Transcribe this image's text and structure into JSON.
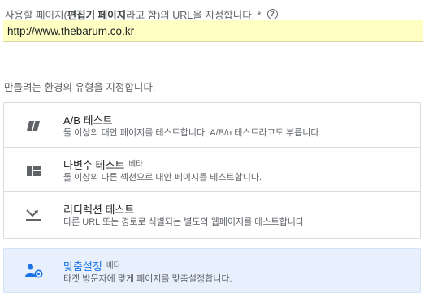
{
  "url_section": {
    "label_prefix": "사용할 페이지(",
    "label_bold": "편집기 페이지",
    "label_suffix": "라고 함)의 URL을 지정합니다. *",
    "help_icon": "help-circle-icon",
    "url_value": "http://www.thebarum.co.kr"
  },
  "environment": {
    "prompt": "만들려는 환경의 유형을 지정합니다.",
    "options": [
      {
        "icon": "ab-test-icon",
        "title": "A/B 테스트",
        "beta": "",
        "description": "둘 이상의 대안 페이지를 테스트합니다. A/B/n 테스트라고도 부릅니다."
      },
      {
        "icon": "multivariate-grid-icon",
        "title": "다변수 테스트",
        "beta": "베타",
        "description": "둘 이상의 다른 섹션으로 대안 페이지를 테스트합니다."
      },
      {
        "icon": "redirect-arrow-icon",
        "title": "리디렉션 테스트",
        "beta": "",
        "description": "다른 URL 또는 경로로 식별되는 별도의 웹페이지를 테스트합니다."
      }
    ],
    "personalization": {
      "icon": "personalization-user-icon",
      "title": "맞춤설정",
      "beta": "베타",
      "description": "타겟 방문자에 맞게 페이지를 맞춤설정합니다."
    }
  },
  "colors": {
    "field_background": "#ffffc4",
    "selected_background": "#e8f0fe",
    "accent": "#1a73e8",
    "icon": "#5f6368"
  }
}
